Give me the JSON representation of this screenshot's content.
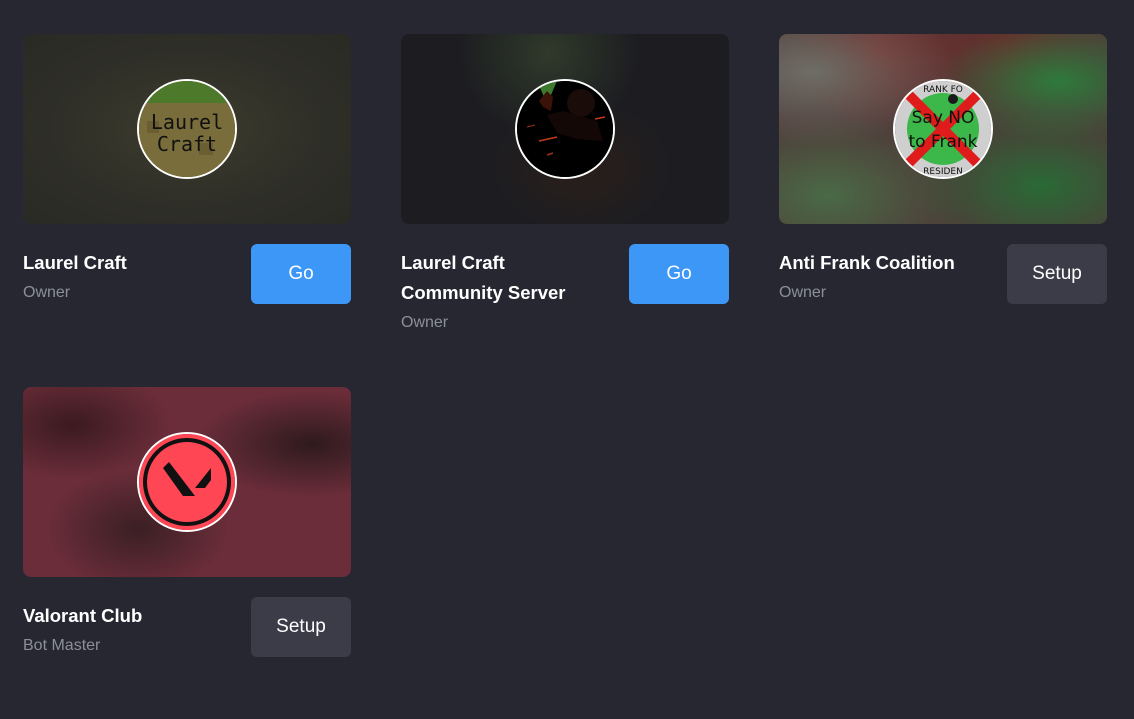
{
  "colors": {
    "background": "#262731",
    "go_button": "#3c97f7",
    "setup_button": "#3b3c47",
    "role_text": "#8d8f98"
  },
  "servers": [
    {
      "name": "Laurel Craft",
      "role": "Owner",
      "action": "Go",
      "avatar_icon": "laurel-craft-logo",
      "avatar_text": [
        "Laurel",
        "Craft"
      ]
    },
    {
      "name": "Laurel Craft Community Server",
      "role": "Owner",
      "action": "Go",
      "avatar_icon": "silhouette-image"
    },
    {
      "name": "Anti Frank Coalition",
      "role": "Owner",
      "action": "Setup",
      "avatar_icon": "say-no-to-frank-logo",
      "avatar_text": [
        "RANK FO",
        "Say NO",
        "to Frank",
        "RESIDEN"
      ]
    },
    {
      "name": "Valorant Club",
      "role": "Bot Master",
      "action": "Setup",
      "avatar_icon": "valorant-logo"
    }
  ]
}
